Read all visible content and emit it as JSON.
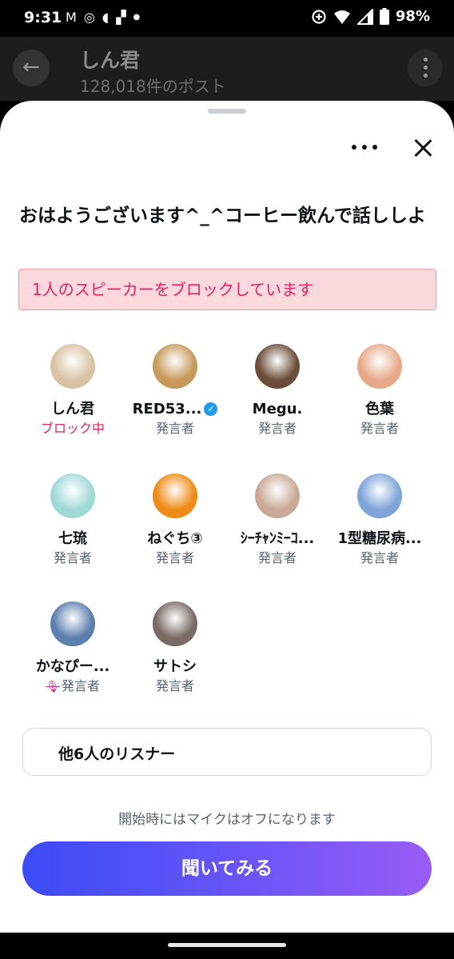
{
  "status_bar": {
    "time": "9:31",
    "battery": "98%",
    "left_icons": [
      "gmail-icon",
      "chrome-icon",
      "nfc-icon",
      "notification-icon",
      "dot-icon"
    ],
    "right_icons": [
      "data-saver-icon",
      "wifi-icon",
      "signal-icon",
      "battery-icon"
    ]
  },
  "background_profile": {
    "title": "しん君",
    "subtitle": "128,018件のポスト"
  },
  "space": {
    "title": "おはようございます^_^コーヒー飲んで話ししよ",
    "block_banner": "1人のスピーカーをブロックしています",
    "speakers": [
      {
        "name": "しん君",
        "role": "ブロック中",
        "blocked": true,
        "avatar": "man-sunglasses",
        "color": "#d9c2a3"
      },
      {
        "name": "RED53...",
        "role": "発言者",
        "verified": true,
        "avatar": "cartoon-character",
        "color": "#c79a5b"
      },
      {
        "name": "Megu.",
        "role": "発言者",
        "avatar": "restaurant-photo",
        "color": "#6b4e3a"
      },
      {
        "name": "色葉",
        "role": "発言者",
        "avatar": "woman-orange-hair",
        "color": "#e8a98a"
      },
      {
        "name": "七琉",
        "role": "発言者",
        "avatar": "anime-girl-headphones",
        "color": "#9fd9d6"
      },
      {
        "name": "ねぐち③",
        "role": "発言者",
        "avatar": "orange-flower",
        "color": "#f08a16"
      },
      {
        "name": "ｼｰﾁｬﾝﾐｰｺ...",
        "role": "発言者",
        "avatar": "cat-photo",
        "color": "#c9a996"
      },
      {
        "name": "1型糖尿病...",
        "role": "発言者",
        "avatar": "blue-sky",
        "color": "#7ea4d8"
      },
      {
        "name": "かなぴー...",
        "role": "発言者",
        "muted": true,
        "avatar": "beer-can",
        "color": "#5d7fb0"
      },
      {
        "name": "サトシ",
        "role": "発言者",
        "avatar": "person-photo",
        "color": "#7a6a66"
      }
    ],
    "listeners_label": "他6人のリスナー",
    "mic_note": "開始時にはマイクはオフになります",
    "listen_button": "聞いてみる"
  }
}
